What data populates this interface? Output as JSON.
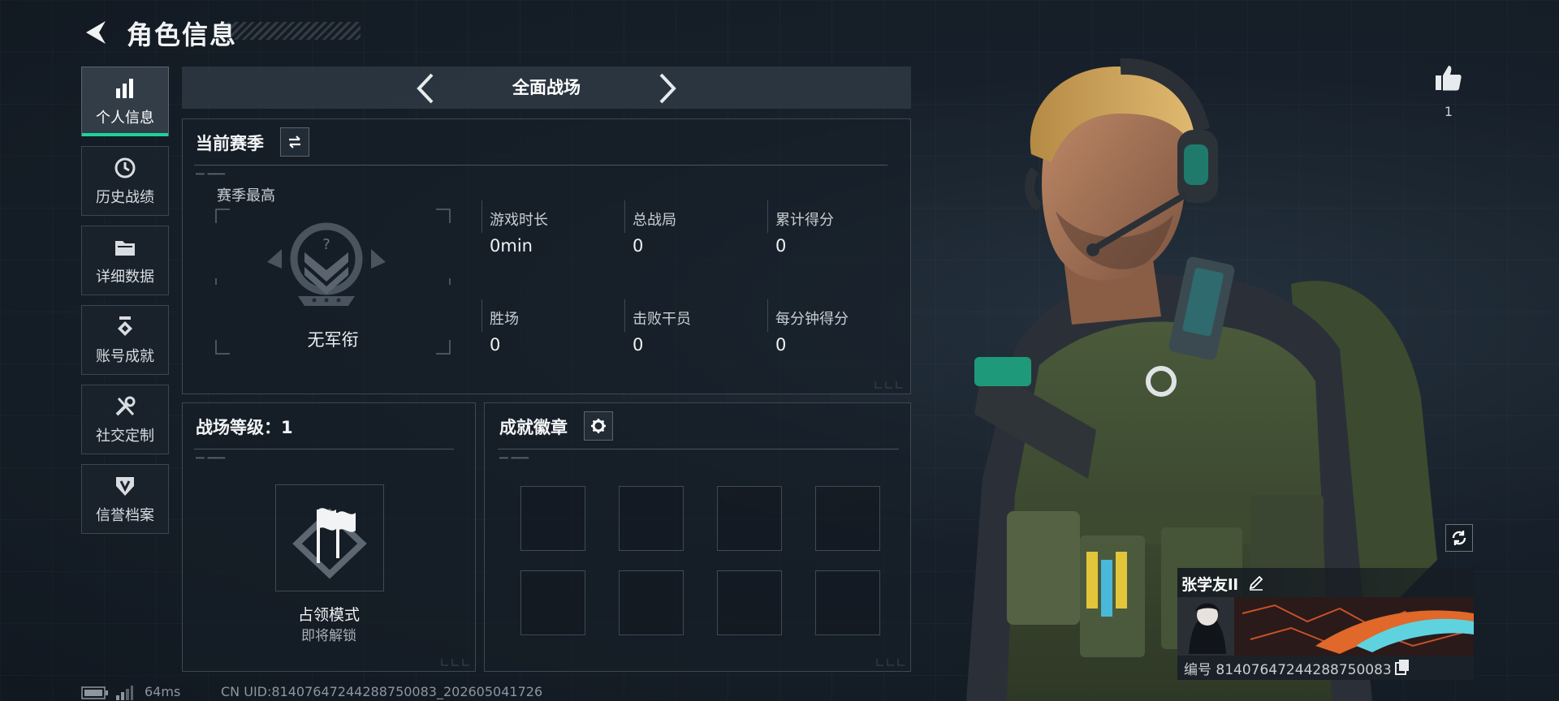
{
  "header": {
    "title": "角色信息"
  },
  "sidebar": {
    "items": [
      {
        "label": "个人信息",
        "icon": "bar-chart-icon",
        "active": true
      },
      {
        "label": "历史战绩",
        "icon": "history-clock-icon",
        "active": false
      },
      {
        "label": "详细数据",
        "icon": "folder-icon",
        "active": false
      },
      {
        "label": "账号成就",
        "icon": "achievement-icon",
        "active": false
      },
      {
        "label": "社交定制",
        "icon": "tools-icon",
        "active": false
      },
      {
        "label": "信誉档案",
        "icon": "reputation-badge-icon",
        "active": false
      }
    ]
  },
  "mode_selector": {
    "label": "全面战场"
  },
  "season": {
    "title": "当前赛季",
    "highest_label": "赛季最高",
    "rank_name": "无军衔",
    "stats": [
      {
        "label": "游戏时长",
        "value": "0min"
      },
      {
        "label": "总战局",
        "value": "0"
      },
      {
        "label": "累计得分",
        "value": "0"
      },
      {
        "label": "胜场",
        "value": "0"
      },
      {
        "label": "击败干员",
        "value": "0"
      },
      {
        "label": "每分钟得分",
        "value": "0"
      }
    ]
  },
  "battlefield_level": {
    "title": "战场等级：1",
    "mode_name": "占领模式",
    "mode_status": "即将解锁"
  },
  "achievements": {
    "title": "成就徽章",
    "slot_count": 8
  },
  "profile": {
    "like_count": "1",
    "player_name": "张学友ll",
    "player_id": "编号 81407647244288750083"
  },
  "status_bar": {
    "ping": "64ms",
    "uid": "CN UID:81407647244288750083_202605041726"
  },
  "colors": {
    "accent": "#1fd29b",
    "panel_border": "#3c4853"
  }
}
